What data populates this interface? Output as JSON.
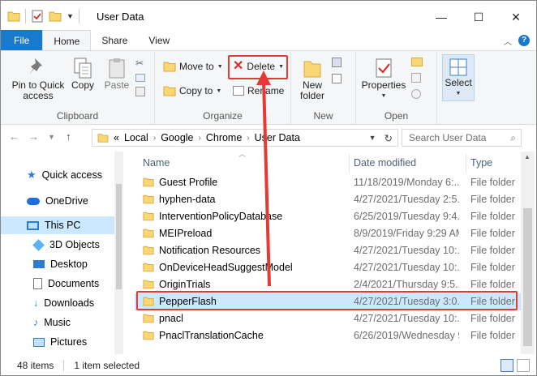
{
  "window": {
    "title": "User Data",
    "controls": {
      "minimize": "—",
      "maximize": "☐",
      "close": "✕"
    }
  },
  "tabs": [
    {
      "label": "File"
    },
    {
      "label": "Home"
    },
    {
      "label": "Share"
    },
    {
      "label": "View"
    }
  ],
  "ribbon": {
    "clipboard": {
      "pin_label": "Pin to Quick access",
      "copy_label": "Copy",
      "paste_label": "Paste",
      "group_label": "Clipboard"
    },
    "organize": {
      "move_to_label": "Move to",
      "copy_to_label": "Copy to",
      "delete_label": "Delete",
      "rename_label": "Rename",
      "group_label": "Organize"
    },
    "new": {
      "new_folder_label": "New folder",
      "group_label": "New"
    },
    "open": {
      "properties_label": "Properties",
      "group_label": "Open"
    },
    "select": {
      "select_label": "Select"
    }
  },
  "address": {
    "crumbs": [
      "Local",
      "Google",
      "Chrome",
      "User Data"
    ],
    "overflow": "«",
    "search_placeholder": "Search User Data"
  },
  "nav": {
    "items": [
      {
        "label": "Quick access",
        "icon": "star-icon"
      },
      {
        "label": "OneDrive",
        "icon": "cloud-icon"
      },
      {
        "label": "This PC",
        "icon": "computer-icon"
      },
      {
        "label": "3D Objects",
        "icon": "cube-icon"
      },
      {
        "label": "Desktop",
        "icon": "desktop-icon"
      },
      {
        "label": "Documents",
        "icon": "document-icon"
      },
      {
        "label": "Downloads",
        "icon": "download-icon"
      },
      {
        "label": "Music",
        "icon": "music-icon"
      },
      {
        "label": "Pictures",
        "icon": "picture-icon"
      }
    ]
  },
  "list": {
    "columns": {
      "name": "Name",
      "date": "Date modified",
      "type": "Type"
    },
    "rows": [
      {
        "name": "Guest Profile",
        "date": "11/18/2019/Monday 6:...",
        "type": "File folder"
      },
      {
        "name": "hyphen-data",
        "date": "4/27/2021/Tuesday 2:5...",
        "type": "File folder"
      },
      {
        "name": "InterventionPolicyDatabase",
        "date": "6/25/2019/Tuesday 9:4...",
        "type": "File folder"
      },
      {
        "name": "MEIPreload",
        "date": "8/9/2019/Friday 9:29 AM",
        "type": "File folder"
      },
      {
        "name": "Notification Resources",
        "date": "4/27/2021/Tuesday 10:...",
        "type": "File folder"
      },
      {
        "name": "OnDeviceHeadSuggestModel",
        "date": "4/27/2021/Tuesday 10:...",
        "type": "File folder"
      },
      {
        "name": "OriginTrials",
        "date": "2/4/2021/Thursday 9:5...",
        "type": "File folder"
      },
      {
        "name": "PepperFlash",
        "date": "4/27/2021/Tuesday 3:0...",
        "type": "File folder"
      },
      {
        "name": "pnacl",
        "date": "4/27/2021/Tuesday 10:...",
        "type": "File folder"
      },
      {
        "name": "PnaclTranslationCache",
        "date": "6/26/2019/Wednesday 9...",
        "type": "File folder"
      }
    ]
  },
  "status": {
    "item_count": "48 items",
    "selected": "1 item selected"
  },
  "colors": {
    "accent": "#1979ca",
    "highlight": "#e53935",
    "selection": "#cce8ff",
    "folder": "#f8d775"
  }
}
